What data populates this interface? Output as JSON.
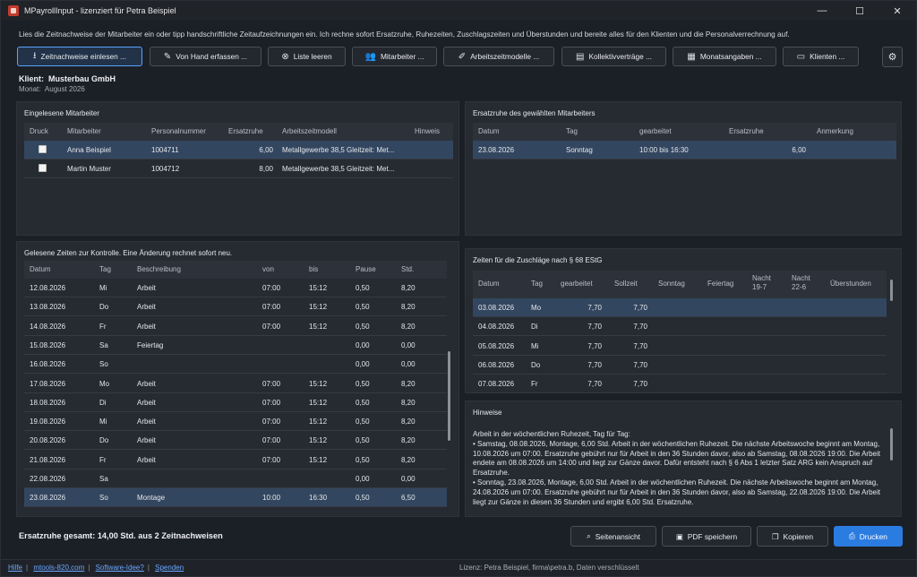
{
  "window": {
    "title": "MPayrollInput - lizenziert für Petra Beispiel",
    "controls": [
      "minimize-icon",
      "maximize-icon",
      "close-icon"
    ]
  },
  "intro_text": "Lies die Zeitnachweise der Mitarbeiter ein oder tipp handschriftliche Zeitaufzeichnungen ein. Ich rechne sofort Ersatzruhe, Ruhezeiten, Zuschlagszeiten und Überstunden und bereite alles für den Klienten und die Personalverrechnung auf.",
  "toolbar": [
    {
      "label": "Zeitnachweise einlesen ...",
      "icon": "import-icon",
      "glyph": "⭳"
    },
    {
      "label": "Von Hand erfassen ...",
      "icon": "hand-icon",
      "glyph": "✎"
    },
    {
      "label": "Liste leeren",
      "icon": "clear-icon",
      "glyph": "⊗"
    },
    {
      "label": "Mitarbeiter ...",
      "icon": "users-icon",
      "glyph": "👥"
    },
    {
      "label": "Arbeitszeitmodelle ...",
      "icon": "edit-icon",
      "glyph": "✐"
    },
    {
      "label": "Kollektivverträge ...",
      "icon": "document-icon",
      "glyph": "▤"
    },
    {
      "label": "Monatsangaben ...",
      "icon": "calendar-icon",
      "glyph": "▦"
    },
    {
      "label": "Klienten ...",
      "icon": "client-icon",
      "glyph": "▭"
    }
  ],
  "settings_icon": "⚙",
  "client": {
    "label": "Klient:",
    "name": "Musterbau GmbH",
    "month_label": "Monat:",
    "month": "August 2026"
  },
  "employees_panel": {
    "title": "Eingelesene Mitarbeiter",
    "columns": [
      "Druck",
      "Mitarbeiter",
      "Personalnummer",
      "Ersatzruhe",
      "Arbeitszeitmodell",
      "Hinweis"
    ],
    "rows": [
      {
        "name": "Anna Beispiel",
        "nr": "1004711",
        "ersatzruhe": "6,00",
        "modell": "Metallgewerbe 38,5 Gleitzeit: Met...",
        "hinweis": "",
        "checked": false
      },
      {
        "name": "Martin Muster",
        "nr": "1004712",
        "ersatzruhe": "8,00",
        "modell": "Metallgewerbe 38,5 Gleitzeit: Met...",
        "hinweis": "",
        "checked": false
      }
    ]
  },
  "ersatzruhe_panel": {
    "title": "Ersatzruhe des gewählten Mitarbeiters",
    "columns": [
      "Datum",
      "Tag",
      "gearbeitet",
      "Ersatzruhe",
      "Anmerkung"
    ],
    "rows": [
      {
        "datum": "23.08.2026",
        "tag": "Sonntag",
        "gearbeitet": "10:00 bis 16:30",
        "ersatzruhe": "6,00",
        "anmerkung": ""
      }
    ]
  },
  "times_panel": {
    "title": "Gelesene Zeiten zur Kontrolle. Eine Änderung rechnet sofort neu.",
    "columns": [
      "Datum",
      "Tag",
      "Beschreibung",
      "von",
      "bis",
      "Pause",
      "Std."
    ],
    "rows": [
      {
        "datum": "12.08.2026",
        "tag": "Mi",
        "beschreibung": "Arbeit",
        "von": "07:00",
        "bis": "15:12",
        "pause": "0,50",
        "std": "8,20"
      },
      {
        "datum": "13.08.2026",
        "tag": "Do",
        "beschreibung": "Arbeit",
        "von": "07:00",
        "bis": "15:12",
        "pause": "0,50",
        "std": "8,20"
      },
      {
        "datum": "14.08.2026",
        "tag": "Fr",
        "beschreibung": "Arbeit",
        "von": "07:00",
        "bis": "15:12",
        "pause": "0,50",
        "std": "8,20"
      },
      {
        "datum": "15.08.2026",
        "tag": "Sa",
        "beschreibung": "Feiertag",
        "von": "",
        "bis": "",
        "pause": "0,00",
        "std": "0,00"
      },
      {
        "datum": "16.08.2026",
        "tag": "So",
        "beschreibung": "",
        "von": "",
        "bis": "",
        "pause": "0,00",
        "std": "0,00"
      },
      {
        "datum": "17.08.2026",
        "tag": "Mo",
        "beschreibung": "Arbeit",
        "von": "07:00",
        "bis": "15:12",
        "pause": "0,50",
        "std": "8,20"
      },
      {
        "datum": "18.08.2026",
        "tag": "Di",
        "beschreibung": "Arbeit",
        "von": "07:00",
        "bis": "15:12",
        "pause": "0,50",
        "std": "8,20"
      },
      {
        "datum": "19.08.2026",
        "tag": "Mi",
        "beschreibung": "Arbeit",
        "von": "07:00",
        "bis": "15:12",
        "pause": "0,50",
        "std": "8,20"
      },
      {
        "datum": "20.08.2026",
        "tag": "Do",
        "beschreibung": "Arbeit",
        "von": "07:00",
        "bis": "15:12",
        "pause": "0,50",
        "std": "8,20"
      },
      {
        "datum": "21.08.2026",
        "tag": "Fr",
        "beschreibung": "Arbeit",
        "von": "07:00",
        "bis": "15:12",
        "pause": "0,50",
        "std": "8,20"
      },
      {
        "datum": "22.08.2026",
        "tag": "Sa",
        "beschreibung": "",
        "von": "",
        "bis": "",
        "pause": "0,00",
        "std": "0,00"
      },
      {
        "datum": "23.08.2026",
        "tag": "So",
        "beschreibung": "Montage",
        "von": "10:00",
        "bis": "16:30",
        "pause": "0,50",
        "std": "6,50"
      }
    ]
  },
  "zuschlag_panel": {
    "title": "Zeiten für die Zuschläge nach § 68 EStG",
    "columns": [
      "Datum",
      "Tag",
      "gearbeitet",
      "Sollzeit",
      "Sonntag",
      "Feiertag",
      "Nacht 19-7",
      "Nacht 22-6",
      "Überstunden"
    ],
    "rows": [
      {
        "datum": "03.08.2026",
        "tag": "Mo",
        "gearbeitet": "7,70",
        "sollzeit": "7,70"
      },
      {
        "datum": "04.08.2026",
        "tag": "Di",
        "gearbeitet": "7,70",
        "sollzeit": "7,70"
      },
      {
        "datum": "05.08.2026",
        "tag": "Mi",
        "gearbeitet": "7,70",
        "sollzeit": "7,70"
      },
      {
        "datum": "06.08.2026",
        "tag": "Do",
        "gearbeitet": "7,70",
        "sollzeit": "7,70"
      },
      {
        "datum": "07.08.2026",
        "tag": "Fr",
        "gearbeitet": "7,70",
        "sollzeit": "7,70"
      }
    ]
  },
  "hints_panel": {
    "title": "Hinweise",
    "lines": [
      "Arbeit in der wöchentlichen Ruhezeit, Tag für Tag:",
      "• Samstag, 08.08.2026, Montage, 6,00 Std. Arbeit in der wöchentlichen Ruhezeit. Die nächste Arbeitswoche beginnt am Montag, 10.08.2026 um 07:00. Ersatzruhe gebührt nur für Arbeit in den 36 Stunden davor, also ab Samstag, 08.08.2026 19:00. Die Arbeit endete am 08.08.2026 um 14:00 und liegt zur Gänze davor. Dafür entsteht nach § 6 Abs 1 letzter Satz ARG kein Anspruch auf Ersatzruhe.",
      "• Sonntag, 23.08.2026, Montage, 6,00 Std. Arbeit in der wöchentlichen Ruhezeit. Die nächste Arbeitswoche beginnt am Montag, 24.08.2026 um 07:00. Ersatzruhe gebührt nur für Arbeit in den 36 Stunden davor, also ab Samstag, 22.08.2026 19:00. Die Arbeit liegt zur Gänze in diesen 36 Stunden und ergibt 6,00 Std. Ersatzruhe."
    ]
  },
  "summary": "Ersatzruhe gesamt: 14,00 Std. aus 2 Zeitnachweisen",
  "bottom_buttons": [
    {
      "label": "Seitenansicht",
      "icon": "preview-icon",
      "glyph": "⌕"
    },
    {
      "label": "PDF speichern",
      "icon": "pdf-icon",
      "glyph": "▣"
    },
    {
      "label": "Kopieren",
      "icon": "copy-icon",
      "glyph": "❐"
    },
    {
      "label": "Drucken",
      "icon": "print-icon",
      "glyph": "⎙"
    }
  ],
  "footer": {
    "links": [
      "Hilfe",
      "mtools-820.com",
      "Software-Idee?",
      "Spenden"
    ],
    "license": "Lizenz: Petra Beispiel, firma\\petra.b, Daten verschlüsselt"
  }
}
